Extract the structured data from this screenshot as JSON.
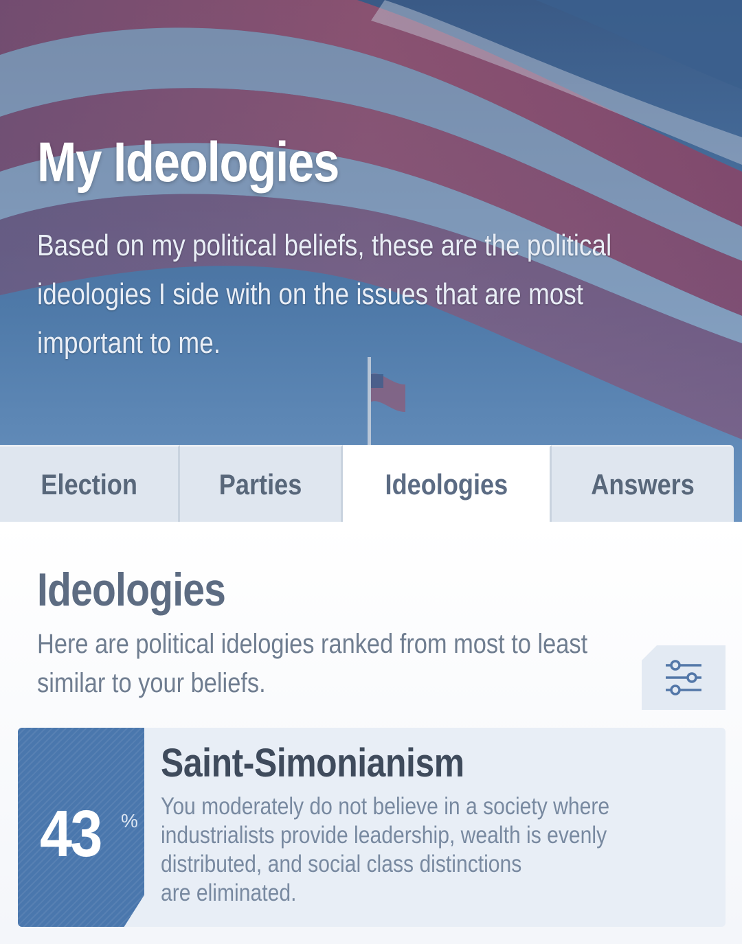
{
  "header": {
    "title": "My Ideologies",
    "description_lines": [
      "Based on my political beliefs, these are the political",
      "ideologies I side with on the issues that are most",
      "important to me."
    ]
  },
  "tabs": [
    {
      "label": "Election",
      "active": false
    },
    {
      "label": "Parties",
      "active": false
    },
    {
      "label": "Ideologies",
      "active": true
    },
    {
      "label": "Answers",
      "active": false
    }
  ],
  "section": {
    "title": "Ideologies",
    "description_lines": [
      "Here are political idelogies ranked from most to least",
      "similar to your beliefs."
    ],
    "filter_icon": "sliders-icon"
  },
  "results": [
    {
      "score": "43",
      "score_unit": "%",
      "name": "Saint-Simonianism",
      "description_lines": [
        "You moderately do not believe in a society where",
        "industrialists provide leadership, wealth is evenly",
        "distributed, and social class distinctions",
        "are eliminated."
      ]
    }
  ],
  "colors": {
    "accent": "#4a77ad",
    "tab_bg": "#dfe6ef",
    "card_bg": "#e8eef6",
    "text_muted": "#7889a0"
  }
}
